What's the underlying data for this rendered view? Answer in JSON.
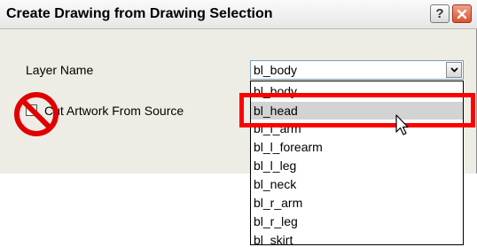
{
  "dialog": {
    "title": "Create Drawing from Drawing Selection",
    "help_label": "?",
    "close_label": "✕"
  },
  "form": {
    "layer_name_label": "Layer Name",
    "layer_name_value": "bl_body",
    "cut_artwork_label": "Cut Artwork From Source",
    "cut_artwork_checked": false
  },
  "dropdown": {
    "items": [
      "bl_body",
      "bl_head",
      "bl_l_arm",
      "bl_l_forearm",
      "bl_l_leg",
      "bl_neck",
      "bl_r_arm",
      "bl_r_leg",
      "bl_skirt"
    ],
    "selected_index": 1
  },
  "icons": {
    "no_sign": "prohibition-icon",
    "cursor": "mouse-pointer-icon",
    "dropdown_arrow": "chevron-down-icon"
  },
  "colors": {
    "highlight": "#ff0000",
    "selected_row": "#d3d3d3"
  }
}
